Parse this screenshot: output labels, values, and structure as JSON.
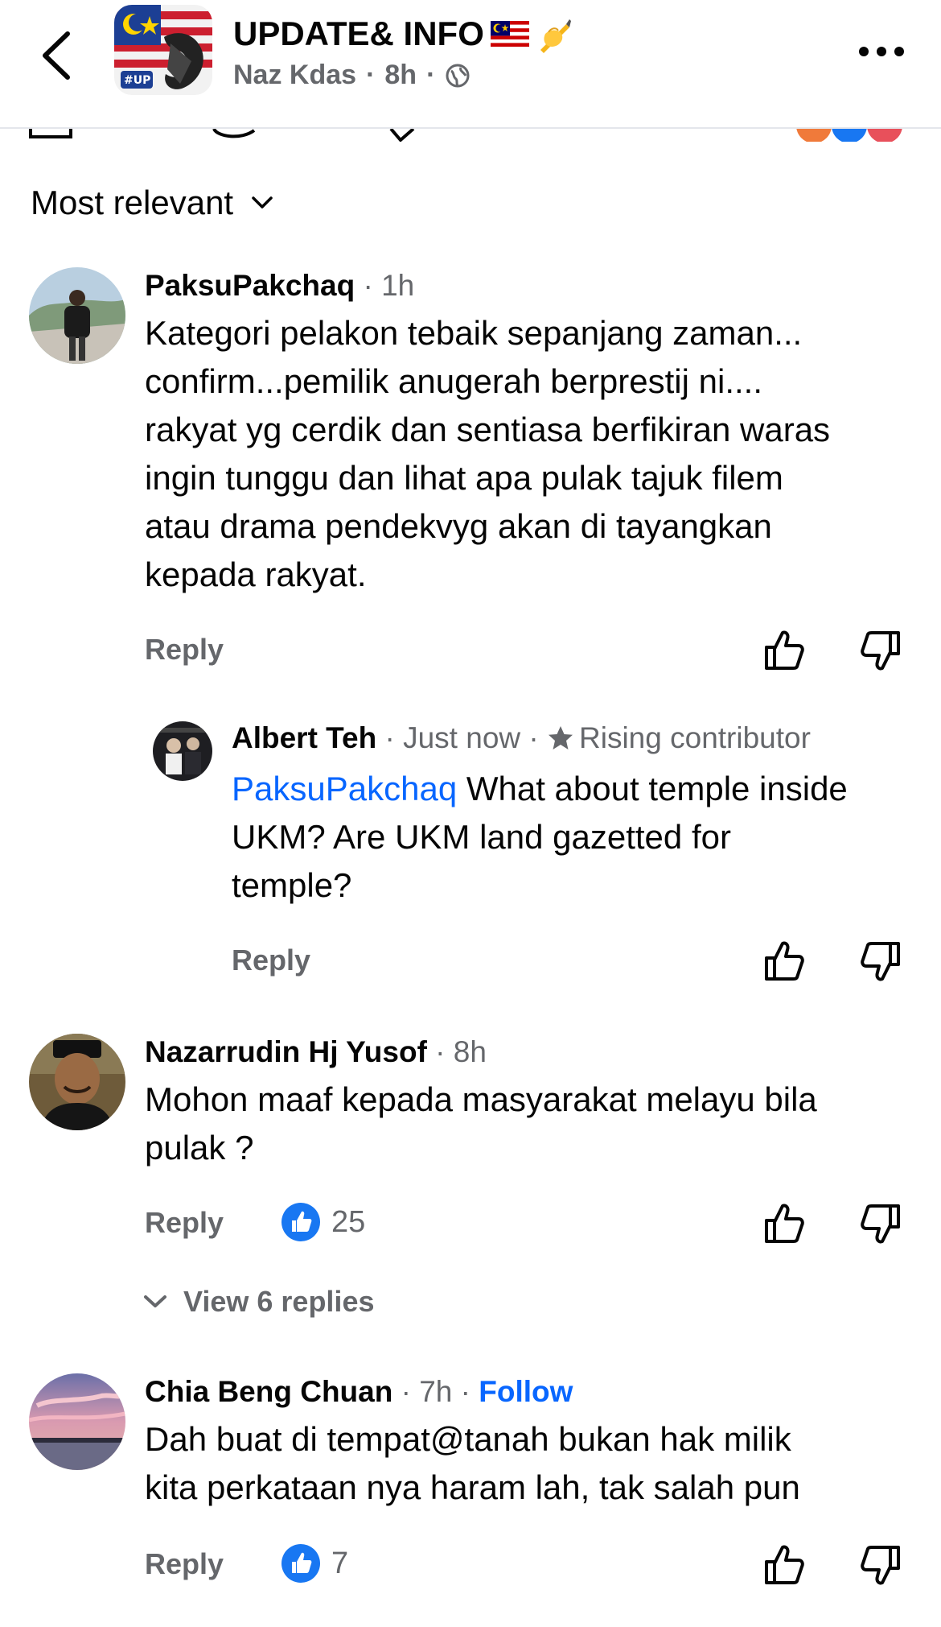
{
  "header": {
    "title": "UPDATE& INFO",
    "title_emoji": "🇲🇾✍️",
    "author": "Naz Kdas",
    "time": "8h",
    "audience_icon": "globe-icon",
    "more_icon": "more-horizontal-icon",
    "back_icon": "chevron-left-icon"
  },
  "sort": {
    "label": "Most relevant",
    "icon": "chevron-down-icon"
  },
  "comments": [
    {
      "author": "PaksuPakchaq",
      "time": "1h",
      "text": "Kategori pelakon tebaik sepanjang zaman... confirm...pemilik anugerah berprestij ni.... rakyat yg cerdik dan sentiasa berfikiran waras ingin tunggu dan lihat apa pulak tajuk filem atau drama pendekvyg akan di tayangkan kepada rakyat.",
      "lines": [
        "Kategori pelakon tebaik sepanjang zaman...",
        "confirm...pemilik anugerah berprestij ni....",
        "rakyat yg cerdik dan sentiasa berfikiran waras",
        "ingin tunggu dan lihat apa pulak tajuk filem",
        "atau drama pendekvyg akan di tayangkan",
        "kepada rakyat."
      ],
      "reply_label": "Reply"
    },
    {
      "author": "Albert Teh",
      "time": "Just now",
      "badge": "Rising contributor",
      "mention": "PaksuPakchaq",
      "text": "What about temple inside UKM? Are UKM land gazetted for temple?",
      "lines": [
        "What about temple inside",
        "UKM? Are UKM land gazetted for",
        "temple?"
      ],
      "reply_label": "Reply"
    },
    {
      "author": "Nazarrudin Hj Yusof",
      "time": "8h",
      "text": "Mohon maaf kepada masyarakat melayu bila pulak ?",
      "lines": [
        "Mohon maaf kepada masyarakat melayu bila",
        "pulak ?"
      ],
      "reply_label": "Reply",
      "likes": "25",
      "view_replies": "View 6 replies"
    },
    {
      "author": "Chia Beng Chuan",
      "time": "7h",
      "follow": "Follow",
      "text": "Dah buat di tempat@tanah bukan hak milik kita perkataan nya haram lah, tak salah pun",
      "lines": [
        "Dah buat di tempat@tanah bukan hak milik",
        "kita perkataan nya haram lah, tak salah pun"
      ],
      "reply_label": "Reply",
      "likes": "7"
    }
  ],
  "colors": {
    "link_blue": "#0866ff",
    "secondary_text": "#65676b",
    "primary_text": "#050505",
    "like_blue": "#1877f2"
  }
}
